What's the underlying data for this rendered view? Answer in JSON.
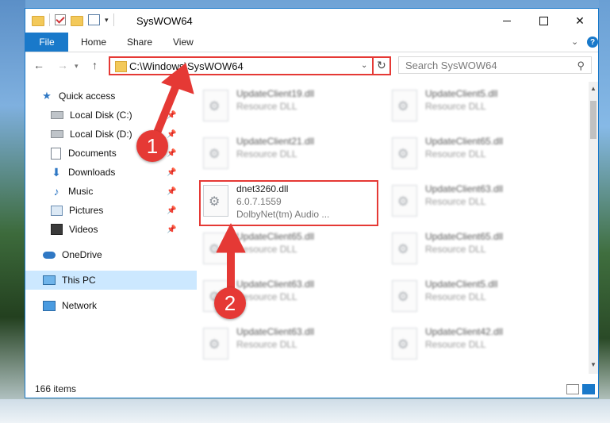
{
  "window": {
    "title": "SysWOW64"
  },
  "ribbon": {
    "tabs": [
      "File",
      "Home",
      "Share",
      "View"
    ]
  },
  "address": {
    "path": "C:\\Windows\\SysWOW64"
  },
  "search": {
    "placeholder": "Search SysWOW64"
  },
  "sidebar": {
    "items": [
      {
        "label": "Quick access",
        "icon": "star-icon",
        "pinned": false
      },
      {
        "label": "Local Disk (C:)",
        "icon": "drive-icon",
        "pinned": true
      },
      {
        "label": "Local Disk (D:)",
        "icon": "drive-icon",
        "pinned": true
      },
      {
        "label": "Documents",
        "icon": "documents-icon",
        "pinned": true
      },
      {
        "label": "Downloads",
        "icon": "download-icon",
        "pinned": true
      },
      {
        "label": "Music",
        "icon": "music-icon",
        "pinned": true
      },
      {
        "label": "Pictures",
        "icon": "pictures-icon",
        "pinned": true
      },
      {
        "label": "Videos",
        "icon": "video-icon",
        "pinned": true
      },
      {
        "label": "OneDrive",
        "icon": "cloud-icon",
        "pinned": false
      },
      {
        "label": "This PC",
        "icon": "computer-icon",
        "pinned": false,
        "selected": true
      },
      {
        "label": "Network",
        "icon": "network-icon",
        "pinned": false
      }
    ]
  },
  "files": {
    "left": [
      {
        "name": "UpdateClient19.dll",
        "desc": "Resource DLL",
        "blurred": true
      },
      {
        "name": "UpdateClient21.dll",
        "desc": "Resource DLL",
        "blurred": true
      },
      {
        "name": "dnet3260.dll",
        "desc": "6.0.7.1559",
        "desc2": "DolbyNet(tm) Audio ...",
        "blurred": false
      },
      {
        "name": "UpdateClient65.dll",
        "desc": "Resource DLL",
        "blurred": true
      },
      {
        "name": "UpdateClient63.dll",
        "desc": "Resource DLL",
        "blurred": true
      },
      {
        "name": "UpdateClient63.dll",
        "desc": "Resource DLL",
        "blurred": true
      }
    ],
    "right": [
      {
        "name": "UpdateClient5.dll",
        "desc": "Resource DLL",
        "blurred": true
      },
      {
        "name": "UpdateClient65.dll",
        "desc": "Resource DLL",
        "blurred": true
      },
      {
        "name": "UpdateClient63.dll",
        "desc": "Resource DLL",
        "blurred": true
      },
      {
        "name": "UpdateClient65.dll",
        "desc": "Resource DLL",
        "blurred": true
      },
      {
        "name": "UpdateClient5.dll",
        "desc": "Resource DLL",
        "blurred": true
      },
      {
        "name": "UpdateClient42.dll",
        "desc": "Resource DLL",
        "blurred": true
      }
    ]
  },
  "status": {
    "items_count": "166 items"
  },
  "annotations": {
    "step1": "1",
    "step2": "2",
    "color": "#e53935"
  },
  "colors": {
    "accent": "#1979ca",
    "selection": "#cce8ff"
  }
}
